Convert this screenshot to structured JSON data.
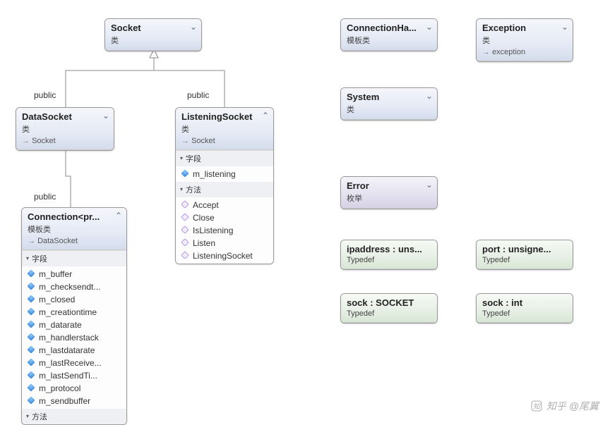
{
  "watermark": "知乎 @尾翼",
  "labels": {
    "public1": "public",
    "public2": "public",
    "public3": "public"
  },
  "boxes": {
    "socket": {
      "title": "Socket",
      "subtitle": "类"
    },
    "datasocket": {
      "title": "DataSocket",
      "subtitle": "类",
      "sup": "Socket"
    },
    "listening": {
      "title": "ListeningSocket",
      "subtitle": "类",
      "sup": "Socket",
      "fields_head": "字段",
      "fields": [
        "m_listening"
      ],
      "methods_head": "方法",
      "methods": [
        "Accept",
        "Close",
        "IsListening",
        "Listen",
        "ListeningSocket"
      ]
    },
    "connection": {
      "title": "Connection<pr...",
      "subtitle": "模板类",
      "sup": "DataSocket",
      "fields_head": "字段",
      "fields": [
        "m_buffer",
        "m_checksendt...",
        "m_closed",
        "m_creationtime",
        "m_datarate",
        "m_handlerstack",
        "m_lastdatarate",
        "m_lastReceive...",
        "m_lastSendTi...",
        "m_protocol",
        "m_sendbuffer"
      ],
      "methods_head": "方法"
    },
    "connhandler": {
      "title": "ConnectionHa...",
      "subtitle": "模板类"
    },
    "exception": {
      "title": "Exception",
      "subtitle": "类",
      "sup": "exception"
    },
    "system": {
      "title": "System",
      "subtitle": "类"
    },
    "error": {
      "title": "Error",
      "subtitle": "枚举"
    },
    "ipaddress": {
      "title": "ipaddress : uns...",
      "subtitle": "Typedef"
    },
    "port": {
      "title": "port : unsigne...",
      "subtitle": "Typedef"
    },
    "sock_socket": {
      "title": "sock : SOCKET",
      "subtitle": "Typedef"
    },
    "sock_int": {
      "title": "sock : int",
      "subtitle": "Typedef"
    }
  }
}
